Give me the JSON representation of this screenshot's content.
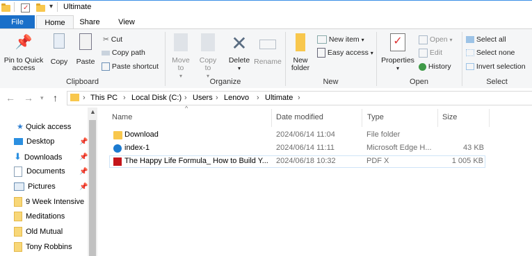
{
  "window": {
    "title": "Ultimate"
  },
  "ribbon_tabs": [
    "File",
    "Home",
    "Share",
    "View"
  ],
  "ribbon": {
    "clipboard": {
      "pin_label": "Pin to Quick access",
      "copy": "Copy",
      "paste": "Paste",
      "cut": "Cut",
      "copy_path": "Copy path",
      "paste_shortcut": "Paste shortcut",
      "group": "Clipboard"
    },
    "organize": {
      "move_to": "Move to",
      "copy_to": "Copy to",
      "delete": "Delete",
      "rename": "Rename",
      "group": "Organize"
    },
    "new": {
      "new_folder": "New folder",
      "new_item": "New item",
      "easy_access": "Easy access",
      "group": "New"
    },
    "open": {
      "properties": "Properties",
      "open": "Open",
      "edit": "Edit",
      "history": "History",
      "group": "Open"
    },
    "select": {
      "select_all": "Select all",
      "select_none": "Select none",
      "invert": "Invert selection",
      "group": "Select"
    }
  },
  "breadcrumb": [
    "This PC",
    "Local Disk (C:)",
    "Users",
    "Lenovo",
    "Ultimate"
  ],
  "nav_pane": {
    "quick_access": "Quick access",
    "items": [
      {
        "label": "Desktop",
        "icon": "desktop-icon",
        "pinned": true
      },
      {
        "label": "Downloads",
        "icon": "download-arrow-icon",
        "pinned": true
      },
      {
        "label": "Documents",
        "icon": "document-icon",
        "pinned": true
      },
      {
        "label": "Pictures",
        "icon": "pictures-icon",
        "pinned": true
      },
      {
        "label": "9 Week Intensive",
        "icon": "folder-icon",
        "pinned": false
      },
      {
        "label": "Meditations",
        "icon": "folder-icon",
        "pinned": false
      },
      {
        "label": "Old Mutual",
        "icon": "folder-icon",
        "pinned": false
      },
      {
        "label": "Tony Robbins",
        "icon": "folder-icon",
        "pinned": false
      }
    ]
  },
  "columns": {
    "name": "Name",
    "date": "Date modified",
    "type": "Type",
    "size": "Size"
  },
  "files": [
    {
      "name": "Download",
      "date": "2024/06/14 11:04",
      "type": "File folder",
      "size": "",
      "icon": "folder-icon"
    },
    {
      "name": "index-1",
      "date": "2024/06/14 11:11",
      "type": "Microsoft Edge H...",
      "size": "43 KB",
      "icon": "edge-icon"
    },
    {
      "name": "The Happy Life Formula_ How to Build Y...",
      "date": "2024/06/18 10:32",
      "type": "PDF X",
      "size": "1 005 KB",
      "icon": "pdf-icon"
    }
  ],
  "colors": {
    "accent": "#1a6fc9",
    "folder": "#f8c74d",
    "selection_border": "#cfe4f7"
  }
}
